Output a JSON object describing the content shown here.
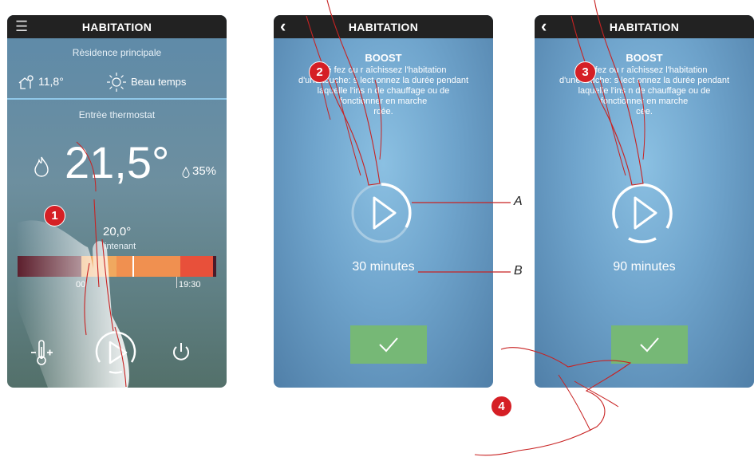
{
  "app": {
    "title": "HABITATION"
  },
  "screen1": {
    "residence": "Rèsidence principale",
    "external_temp": "11,8°",
    "weather": "Beau temps",
    "zone": "Entrèe thermostat",
    "temperature": "21,5°",
    "humidity": "35%",
    "setpoint": "20,0°",
    "now_label": "intenant",
    "time_start": "00",
    "time_end": "19:30",
    "icons": [
      "menu-icon",
      "house-thermometer-icon",
      "sun-icon",
      "flame-icon",
      "drop-icon",
      "thermometer-adjust-icon",
      "boost-play-icon",
      "power-icon"
    ]
  },
  "screen2": {
    "boost_title": "BOOST",
    "description_lines": [
      "Ré    fez ou r    aîchissez l'habitation",
      "d'une touche: s    lect   onnez la durée pendant",
      "laquelle l'ins       n de chauffage ou de",
      "         fonctionner en marche",
      "               rcée."
    ],
    "duration": "30 minutes",
    "progress": 0.33
  },
  "screen3": {
    "boost_title": "BOOST",
    "description_lines": [
      "Ré    fez ou r    aîchissez l'habitation",
      "d'une touche: s    lect   onnez la durée pendant",
      "laquelle l'ins       n de chauffage ou de",
      "          fonctionner en marche",
      "               cée."
    ],
    "duration": "90 minutes",
    "progress": 1.0
  },
  "steps": [
    "1",
    "2",
    "3",
    "4"
  ],
  "callouts": [
    "A",
    "B"
  ],
  "colors": {
    "accent_red": "#d51f25",
    "confirm_green": "#76b876",
    "topbar": "#222222"
  }
}
